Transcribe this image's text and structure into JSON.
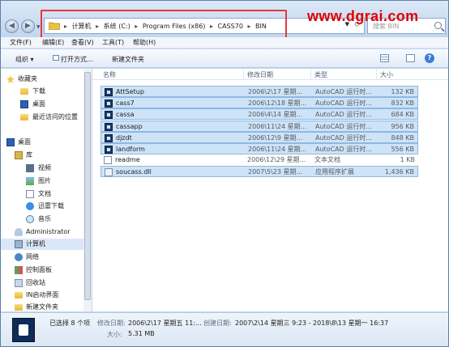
{
  "address": {
    "crumbs": [
      "计算机",
      "系统 (C:)",
      "Program Files (x86)",
      "CASS70",
      "BIN"
    ],
    "search_placeholder": "搜索 BIN"
  },
  "watermark": "www.dgrai.com",
  "menu": [
    "文件(F)",
    "编辑(E)",
    "查看(V)",
    "工具(T)",
    "帮助(H)"
  ],
  "toolbar": {
    "organize": "组织 ▾",
    "open": "打开方式...",
    "new_folder": "新建文件夹"
  },
  "nav": {
    "favorites": "收藏夹",
    "downloads": "下载",
    "desktop_fav": "桌面",
    "recent": "最近访问的位置",
    "desktop": "桌面",
    "library": "库",
    "videos": "视频",
    "pictures": "图片",
    "documents": "文档",
    "xunlei": "迅雷下载",
    "music": "音乐",
    "admin": "Administrator",
    "computer": "计算机",
    "network": "网络",
    "control": "控制面板",
    "recycle": "回收站",
    "in_start": "IN启动界面",
    "new_folder": "新建文件夹"
  },
  "columns": {
    "name": "名称",
    "date": "修改日期",
    "type": "类型",
    "size": "大小"
  },
  "files": [
    {
      "name": "AttSetup",
      "date": "2006\\2\\17 星期...",
      "type": "AutoCAD 运行时...",
      "size": "132 KB",
      "icon": "app",
      "selected": true
    },
    {
      "name": "cass7",
      "date": "2006\\12\\18 星期...",
      "type": "AutoCAD 运行时...",
      "size": "832 KB",
      "icon": "app",
      "selected": true
    },
    {
      "name": "cassa",
      "date": "2006\\4\\14 星期...",
      "type": "AutoCAD 运行时...",
      "size": "684 KB",
      "icon": "app",
      "selected": true
    },
    {
      "name": "cassapp",
      "date": "2006\\11\\24 星期...",
      "type": "AutoCAD 运行时...",
      "size": "956 KB",
      "icon": "app",
      "selected": true
    },
    {
      "name": "djzdt",
      "date": "2006\\12\\9 星期...",
      "type": "AutoCAD 运行时...",
      "size": "848 KB",
      "icon": "app",
      "selected": true
    },
    {
      "name": "landform",
      "date": "2006\\11\\24 星期...",
      "type": "AutoCAD 运行时...",
      "size": "556 KB",
      "icon": "app",
      "selected": true
    },
    {
      "name": "readme",
      "date": "2006\\12\\29 星期...",
      "type": "文本文档",
      "size": "1 KB",
      "icon": "txt",
      "selected": false
    },
    {
      "name": "soucass.dll",
      "date": "2007\\5\\23 星期...",
      "type": "应用程序扩展",
      "size": "1,436 KB",
      "icon": "dll",
      "selected": true
    }
  ],
  "details": {
    "count": "已选择 8 个项",
    "modified_label": "修改日期:",
    "modified_value": "2006\\2\\17 星期五 11:...",
    "created_label": "创建日期:",
    "created_value": "2007\\2\\14 星期三 9:23 - 2018\\8\\13 星期一 16:37",
    "size_label": "大小:",
    "size_value": "5.31 MB"
  }
}
